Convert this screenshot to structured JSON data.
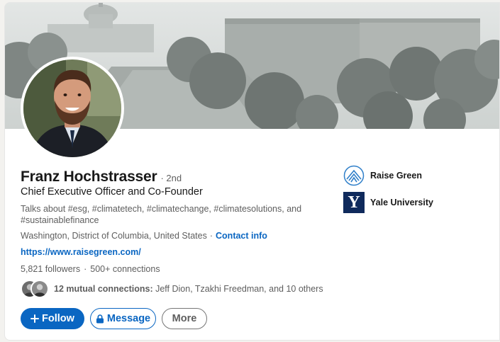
{
  "profile": {
    "name": "Franz Hochstrasser",
    "degree": "· 2nd",
    "headline": "Chief Executive Officer and Co-Founder",
    "about": "Talks about #esg, #climatetech, #climatechange, #climatesolutions, and #sustainablefinance",
    "location": "Washington, District of Columbia, United States",
    "location_sep": "·",
    "contact_label": "Contact info",
    "website": "https://www.raisegreen.com/",
    "followers": "5,821 followers",
    "stats_sep": "·",
    "connections": "500+ connections",
    "mutual_prefix": "12 mutual connections:",
    "mutual_names": "Jeff Dion, Tzakhi Freedman, and 10 others"
  },
  "actions": {
    "follow_label": "Follow",
    "message_label": "Message",
    "more_label": "More"
  },
  "orgs": [
    {
      "name": "Raise Green",
      "icon": "raise-green-logo"
    },
    {
      "name": "Yale University",
      "icon": "yale-logo",
      "logo_letter": "Y"
    }
  ],
  "colors": {
    "brand_blue": "#0a66c2",
    "secondary_text": "#5e5e5e",
    "yale_navy": "#0f2a5c"
  }
}
